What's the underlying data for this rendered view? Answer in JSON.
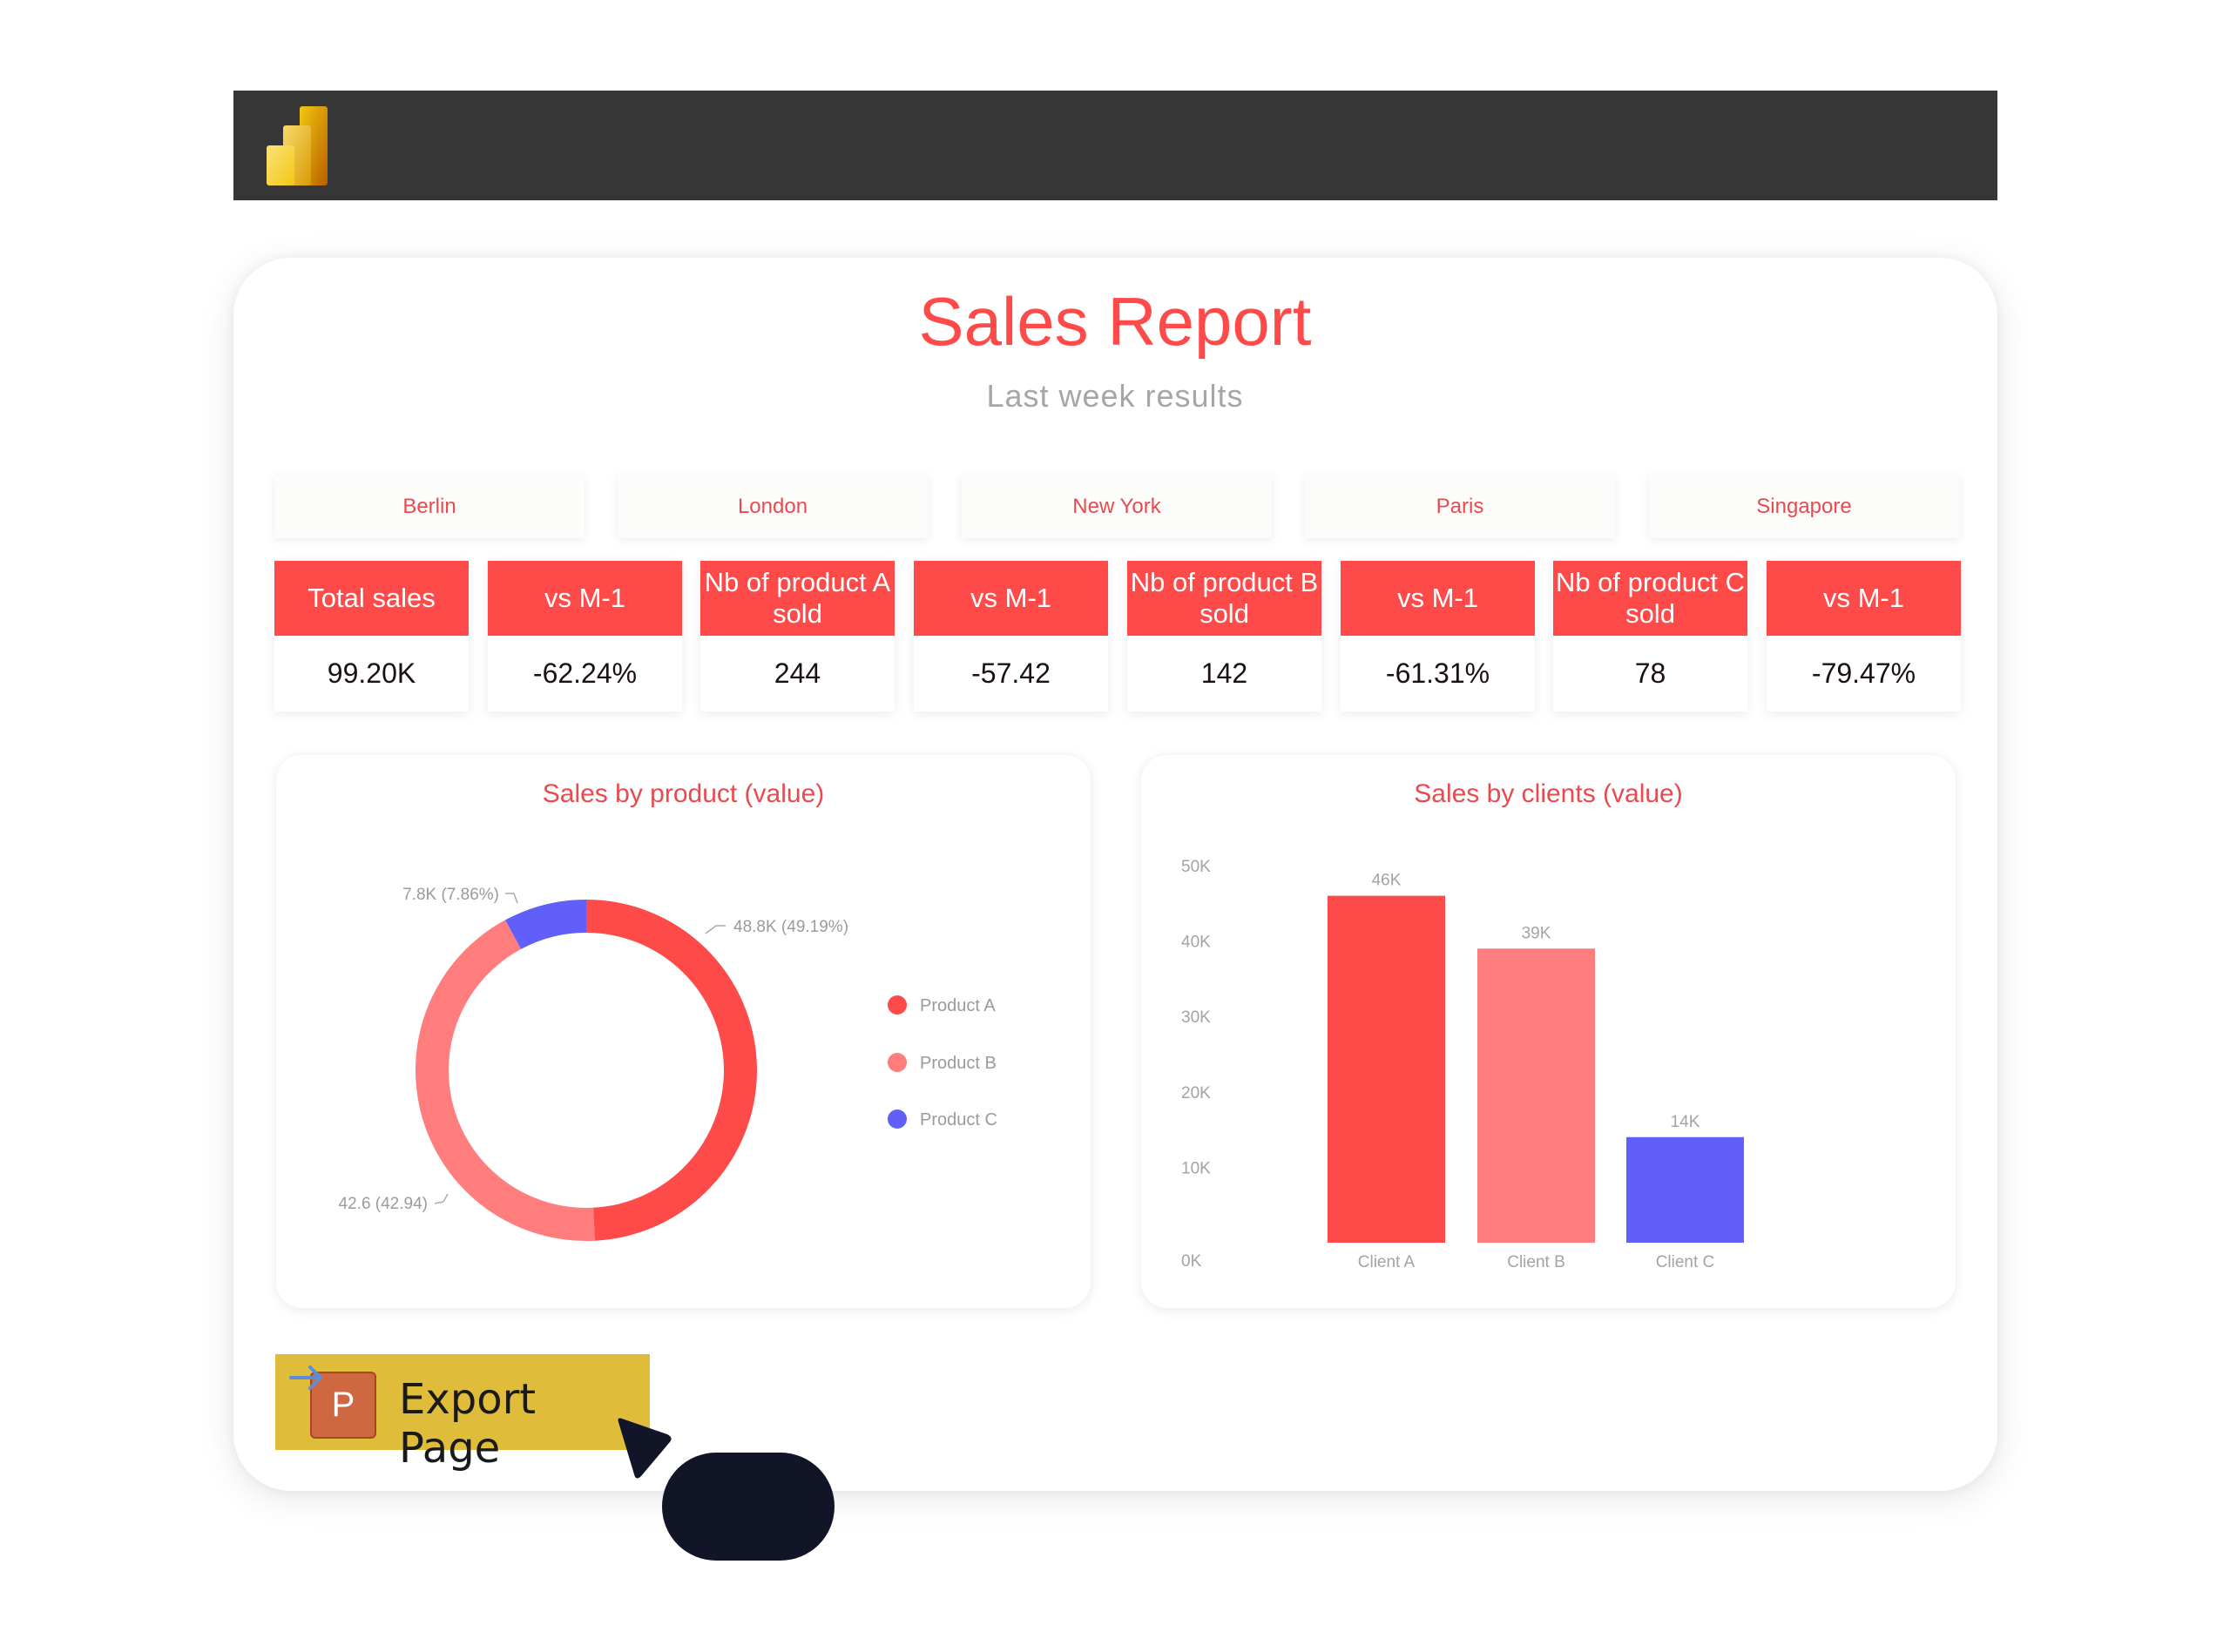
{
  "app": {
    "logo_icon": "power-bi-logo"
  },
  "report": {
    "title": "Sales Report",
    "subtitle": "Last week results"
  },
  "cities": [
    "Berlin",
    "London",
    "New York",
    "Paris",
    "Singapore"
  ],
  "kpis": [
    {
      "label": "Total sales",
      "value": "99.20K"
    },
    {
      "label": "vs M-1",
      "value": "-62.24%"
    },
    {
      "label": "Nb of product A sold",
      "value": "244"
    },
    {
      "label": "vs M-1",
      "value": "-57.42"
    },
    {
      "label": "Nb of product B sold",
      "value": "142"
    },
    {
      "label": "vs M-1",
      "value": "-61.31%"
    },
    {
      "label": "Nb of product C sold",
      "value": "78"
    },
    {
      "label": "vs M-1",
      "value": "-79.47%"
    }
  ],
  "colors": {
    "accent": "#ff4a4a",
    "product_a": "#ff4a4a",
    "product_b": "#ff7d7d",
    "product_c": "#605ff7",
    "header": "#363636",
    "export_button": "#dfbd3a"
  },
  "export_button": {
    "label": "Export Page",
    "icon": "powerpoint-icon",
    "icon_letter": "P"
  },
  "chart_data": [
    {
      "type": "pie",
      "title": "Sales by product (value)",
      "donut": true,
      "categories": [
        "Product A",
        "Product B",
        "Product C"
      ],
      "values": [
        48.8,
        42.6,
        7.8
      ],
      "percentages": [
        49.19,
        42.94,
        7.86
      ],
      "data_labels": [
        "48.8K (49.19%)",
        "42.6 (42.94)",
        "7.8K (7.86%)"
      ],
      "colors": [
        "#ff4a4a",
        "#ff7d7d",
        "#605ff7"
      ],
      "legend": [
        "Product A",
        "Product B",
        "Product C"
      ],
      "legend_position": "right"
    },
    {
      "type": "bar",
      "title": "Sales by clients (value)",
      "categories": [
        "Client A",
        "Client B",
        "Client C"
      ],
      "values": [
        46000,
        39000,
        14000
      ],
      "data_labels": [
        "46K",
        "39K",
        "14K"
      ],
      "colors": [
        "#ff4a4a",
        "#ff7d7d",
        "#605ff7"
      ],
      "yticks": [
        "0K",
        "10K",
        "20K",
        "30K",
        "40K",
        "50K"
      ],
      "ylim": [
        0,
        50000
      ],
      "grid": false,
      "xlabel": "",
      "ylabel": ""
    }
  ]
}
